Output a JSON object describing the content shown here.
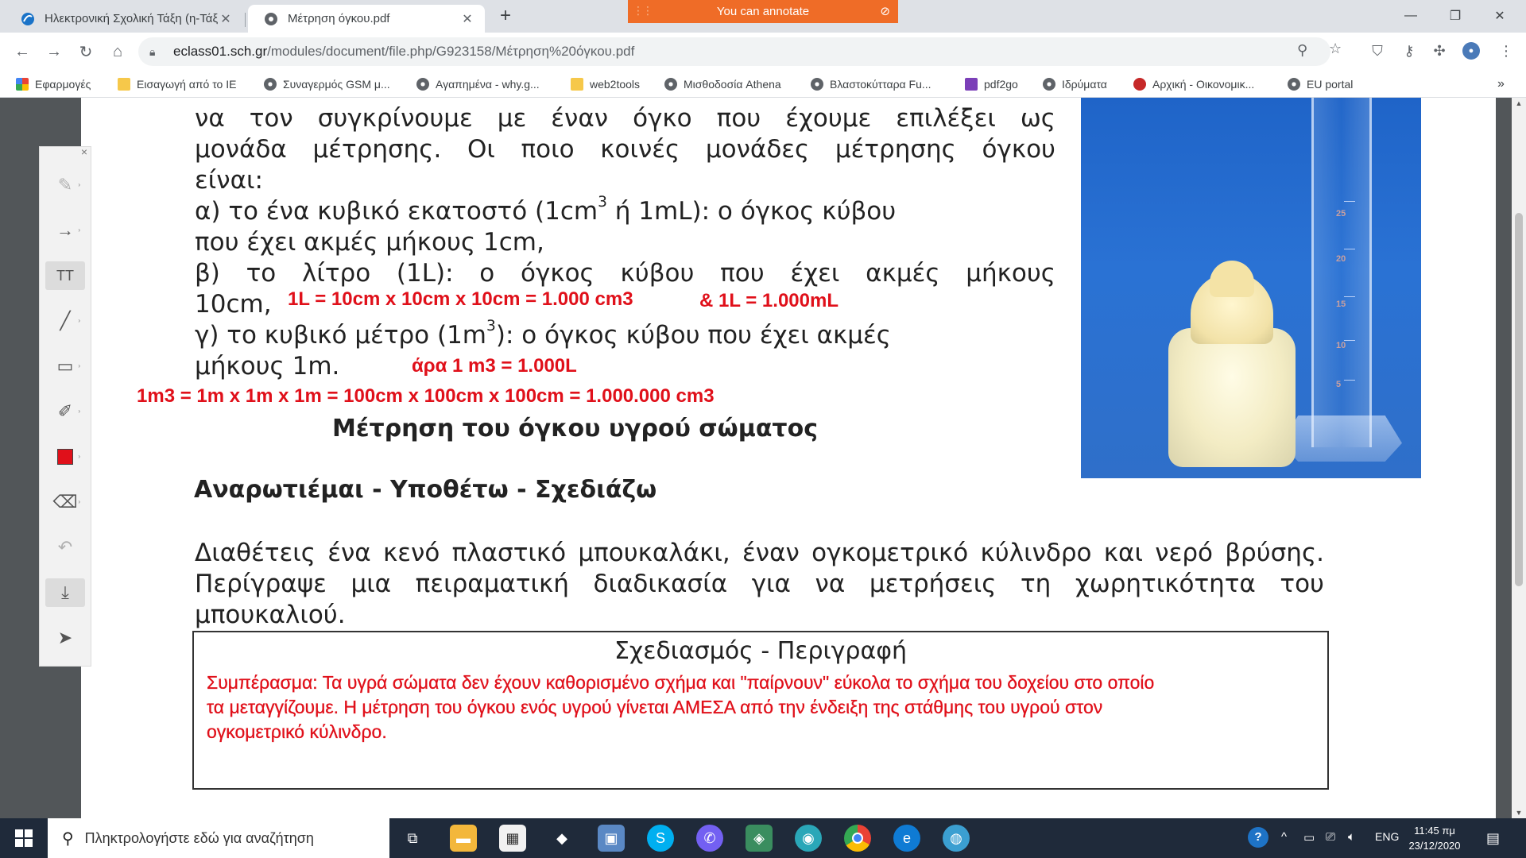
{
  "browser": {
    "tabs": [
      {
        "title": "Ηλεκτρονική Σχολική Τάξη (η-Τάξη)",
        "active": false
      },
      {
        "title": "Μέτρηση όγκου.pdf",
        "active": true
      }
    ],
    "annotate_banner": "You can annotate",
    "url_host": "eclass01.sch.gr",
    "url_path": "/modules/document/file.php/G923158/Μέτρηση%20όγκου.pdf",
    "bookmarks": [
      {
        "label": "Εφαρμογές",
        "icon": "apps-icon"
      },
      {
        "label": "Εισαγωγή από το IE",
        "icon": "folder-icon"
      },
      {
        "label": "Συναγερμός GSM μ...",
        "icon": "globe-icon"
      },
      {
        "label": "Αγαπημένα - why.g...",
        "icon": "globe-icon"
      },
      {
        "label": "web2tools",
        "icon": "folder-icon"
      },
      {
        "label": "Μισθοδοσία Athena",
        "icon": "globe-icon"
      },
      {
        "label": "Βλαστοκύτταρα Fu...",
        "icon": "globe-icon"
      },
      {
        "label": "pdf2go",
        "icon": "pdf2go-icon"
      },
      {
        "label": "Ιδρύματα",
        "icon": "globe-icon"
      },
      {
        "label": "Αρχική - Οικονομικ...",
        "icon": "red-globe-icon"
      },
      {
        "label": "EU portal",
        "icon": "globe-icon"
      }
    ],
    "bookmarks_more": "»"
  },
  "document": {
    "lines": [
      "να τον συγκρίνουμε με έναν όγκο που έχουμε επιλέξει ως",
      "μονάδα μέτρησης. Οι ποιο κοινές μονάδες μέτρησης όγκου",
      "είναι:",
      "α) το ένα κυβικό εκατοστό (1cm",
      "3",
      " ή 1mL): ο όγκος κύβου",
      "που έχει ακμές μήκους 1cm,",
      "β) το λίτρο (1L): ο όγκος κύβου που έχει ακμές μήκους",
      "10cm,",
      "γ) το κυβικό μέτρο (1m",
      "3",
      "): ο όγκος κύβου που έχει ακμές",
      "μήκους 1m."
    ],
    "section_title": "Μέτρηση του όγκου υγρού σώματος",
    "subheading": "Αναρωτιέμαι - Υποθέτω - Σχεδιάζω",
    "paragraph_lines": [
      "Διαθέτεις ένα κενό πλαστικό μπουκαλάκι, έναν ογκομετρικό κύλινδρο και νερό βρύσης.",
      "Περίγραψε μια πειραματική διαδικασία για να μετρήσεις τη χωρητικότητα του",
      "μπουκαλιού."
    ],
    "box_title": "Σχεδιασμός - Περιγραφή",
    "cylinder_marks": [
      "25",
      "20",
      "15",
      "10",
      "5"
    ]
  },
  "annotations": {
    "liter_eq": "1L = 10cm x 10cm x 10cm = 1.000 cm3",
    "liter_ml": "& 1L = 1.000mL",
    "m3_liter": "άρα 1 m3 = 1.000L",
    "m3_eq": "1m3 = 1m x 1m x 1m = 100cm x 100cm x 100cm = 1.000.000 cm3",
    "conclusion_lines": [
      "Συμπέρασμα: Τα υγρά σώματα δεν έχουν καθορισμένο σχήμα και \"παίρνουν\" εύκολα το σχήμα του δοχείου στο οποίο",
      "τα μεταγγίζουμε. Η μέτρηση του όγκου ενός υγρού γίνεται ΑΜΕΣΑ από την ένδειξη της στάθμης του υγρού στον",
      "ογκομετρικό κύλινδρο."
    ]
  },
  "palette": {
    "close": "×",
    "tools": [
      "highlighter-icon",
      "arrow-icon",
      "text-icon",
      "line-icon",
      "rectangle-icon",
      "pen-icon",
      "color-swatch",
      "eraser-icon",
      "undo-icon",
      "save-icon",
      "pointer-icon"
    ],
    "text_tool_label": "TT",
    "active_color": "#e0101a"
  },
  "taskbar": {
    "search_placeholder": "Πληκτρολογήστε εδώ για αναζήτηση",
    "language": "ENG",
    "time": "11:45 πμ",
    "date": "23/12/2020"
  },
  "colors": {
    "annotation_red": "#e0101a",
    "banner_orange": "#ef6c27"
  }
}
